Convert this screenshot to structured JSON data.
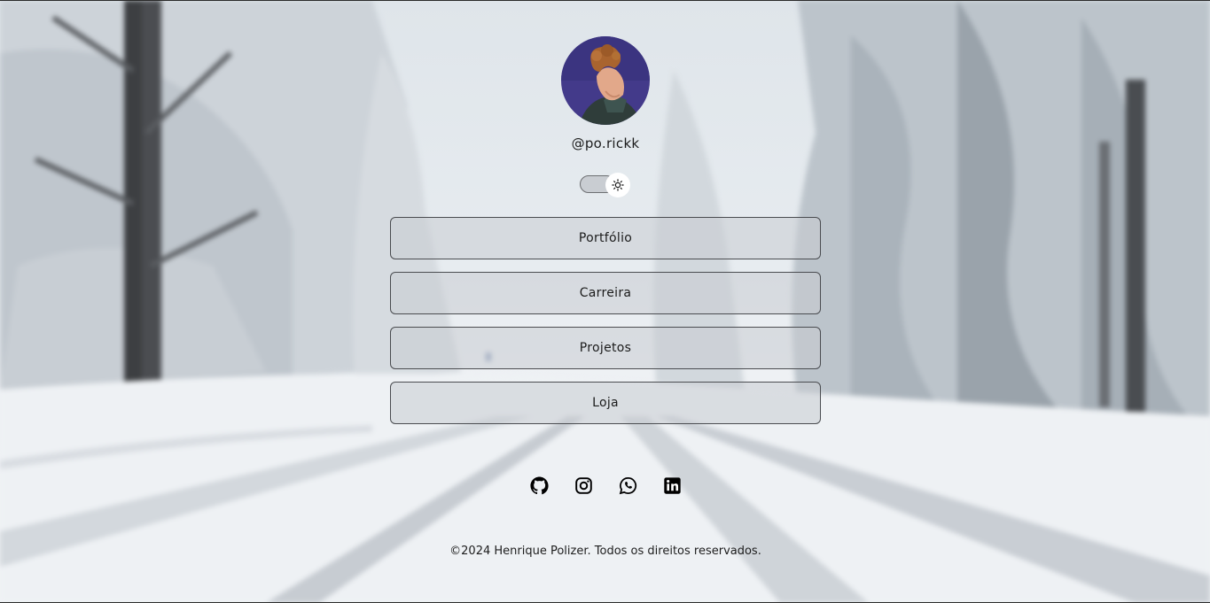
{
  "profile": {
    "username": "@po.rickk",
    "avatar_icon": "profile-photo"
  },
  "theme_toggle": {
    "icon": "sun-icon",
    "state": "light"
  },
  "links": [
    {
      "label": "Portfólio"
    },
    {
      "label": "Carreira"
    },
    {
      "label": "Projetos"
    },
    {
      "label": "Loja"
    }
  ],
  "socials": [
    {
      "name": "github-icon"
    },
    {
      "name": "instagram-icon"
    },
    {
      "name": "whatsapp-icon"
    },
    {
      "name": "linkedin-icon"
    }
  ],
  "footer": {
    "text": "©2024 Henrique Polizer. Todos os direitos reservados."
  },
  "colors": {
    "text": "#1b1b1b",
    "button_border": "#4a4c50",
    "button_fill": "rgba(200,204,210,0.55)"
  }
}
